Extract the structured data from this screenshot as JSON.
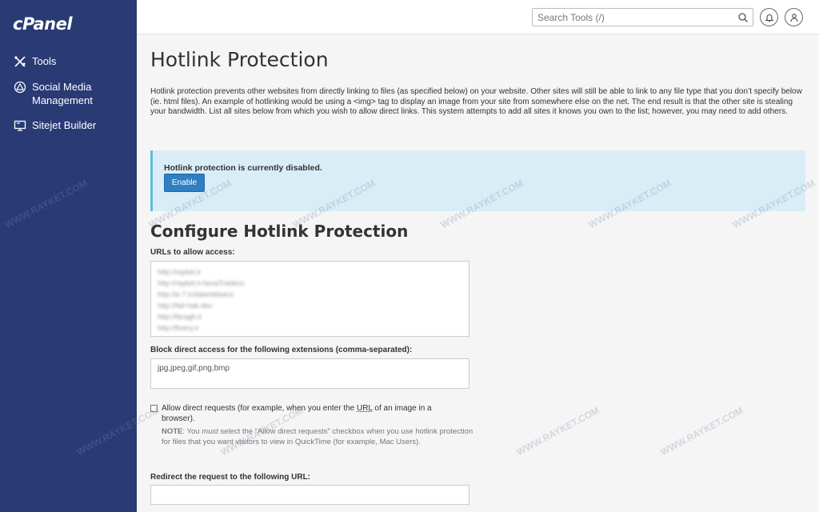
{
  "sidebar": {
    "logo": "cPanel",
    "items": [
      {
        "label": "Tools",
        "icon": "tools-icon"
      },
      {
        "label": "Social Media Management",
        "icon": "social-media-icon"
      },
      {
        "label": "Sitejet Builder",
        "icon": "sitejet-icon"
      }
    ]
  },
  "topbar": {
    "search_placeholder": "Search Tools (/)"
  },
  "page": {
    "title": "Hotlink Protection",
    "description": "Hotlink protection prevents other websites from directly linking to files (as specified below) on your website. Other sites will still be able to link to any file type that you don’t specify below (ie. html files). An example of hotlinking would be using a <img> tag to display an image from your site from somewhere else on the net. The end result is that the other site is stealing your bandwidth. List all sites below from which you wish to allow direct links. This system attempts to add all sites it knows you own to the list; however, you may need to add others.",
    "alert": {
      "text": "Hotlink protection is currently disabled.",
      "button": "Enable"
    },
    "section_title": "Configure Hotlink Protection",
    "urls_label": "URLs to allow access:",
    "urls": [
      "http://rayket.ir",
      "http://rayket.ir.hexaTradeco",
      "http://e-7.ir/datentebanx",
      "http://fail-hak.dev",
      "http://faragh.ir",
      "http://finery.ir"
    ],
    "ext_label": "Block direct access for the following extensions (comma-separated):",
    "ext_value": "jpg,jpeg,gif,png,bmp",
    "allow_direct_pre": "Allow direct requests (for example, when you enter the ",
    "allow_direct_abbr": "URL",
    "allow_direct_post": " of an image in a browser).",
    "note_label": "NOTE",
    "note_1": ": You ",
    "note_must": "must",
    "note_2": " select the “Allow direct requests” checkbox when you use hotlink protection for files that you want visitors to view in QuickTime (for example, Mac Users).",
    "redirect_label": "Redirect the request to the following URL:"
  },
  "watermark": "WWW.RAYKET.COM",
  "colors": {
    "sidebar": "#293a74",
    "alert_bg": "#d9edf7",
    "alert_border": "#5bc0de",
    "primary_button": "#2f7fc1"
  }
}
